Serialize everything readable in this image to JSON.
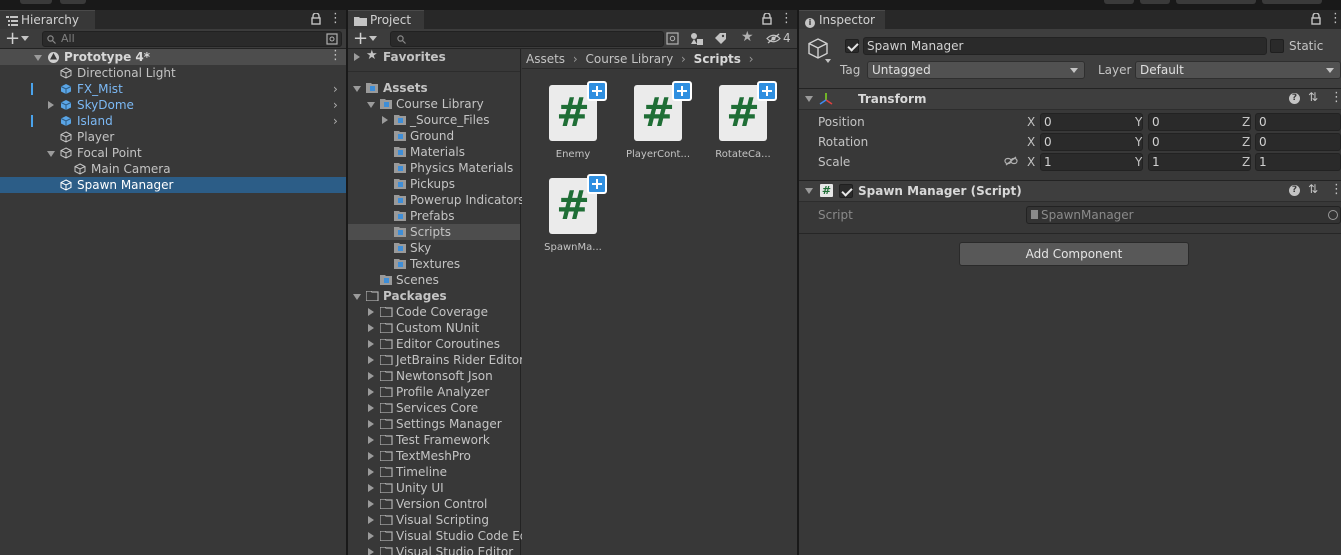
{
  "hierarchy": {
    "tab_label": "Hierarchy",
    "search_placeholder": "All",
    "scene_name": "Prototype 4*",
    "items": [
      {
        "label": "Directional Light"
      },
      {
        "label": "FX_Mist"
      },
      {
        "label": "SkyDome"
      },
      {
        "label": "Island"
      },
      {
        "label": "Player"
      },
      {
        "label": "Focal Point"
      },
      {
        "label": "Main Camera"
      },
      {
        "label": "Spawn Manager"
      }
    ]
  },
  "project": {
    "tab_label": "Project",
    "hidden_count": "4",
    "favorites_label": "Favorites",
    "assets_label": "Assets",
    "course_library_label": "Course Library",
    "folders": [
      "_Source_Files",
      "Ground",
      "Materials",
      "Physics Materials",
      "Pickups",
      "Powerup Indicators",
      "Prefabs",
      "Scripts",
      "Sky",
      "Textures"
    ],
    "scenes_label": "Scenes",
    "packages_label": "Packages",
    "packages": [
      "Code Coverage",
      "Custom NUnit",
      "Editor Coroutines",
      "JetBrains Rider Editor",
      "Newtonsoft Json",
      "Profile Analyzer",
      "Services Core",
      "Settings Manager",
      "Test Framework",
      "TextMeshPro",
      "Timeline",
      "Unity UI",
      "Version Control",
      "Visual Scripting",
      "Visual Studio Code Ed",
      "Visual Studio Editor"
    ],
    "breadcrumb": [
      "Assets",
      "Course Library",
      "Scripts"
    ],
    "assets": [
      "Enemy",
      "PlayerCont...",
      "RotateCa...",
      "SpawnMa..."
    ]
  },
  "inspector": {
    "tab_label": "Inspector",
    "object_name": "Spawn Manager",
    "static_label": "Static",
    "tag_label": "Tag",
    "tag_value": "Untagged",
    "layer_label": "Layer",
    "layer_value": "Default",
    "transform": {
      "title": "Transform",
      "position_label": "Position",
      "rotation_label": "Rotation",
      "scale_label": "Scale",
      "x": "X",
      "y": "Y",
      "z": "Z",
      "position": [
        "0",
        "0",
        "0"
      ],
      "rotation": [
        "0",
        "0",
        "0"
      ],
      "scale": [
        "1",
        "1",
        "1"
      ]
    },
    "script_component": {
      "title": "Spawn Manager (Script)",
      "script_label": "Script",
      "script_value": "SpawnManager"
    },
    "add_component_label": "Add Component"
  },
  "colors": {
    "selection": "#2c5d87",
    "prefab_text": "#7cb9f5",
    "script_hash": "#1f6e36",
    "badge": "#2f8fe0"
  }
}
